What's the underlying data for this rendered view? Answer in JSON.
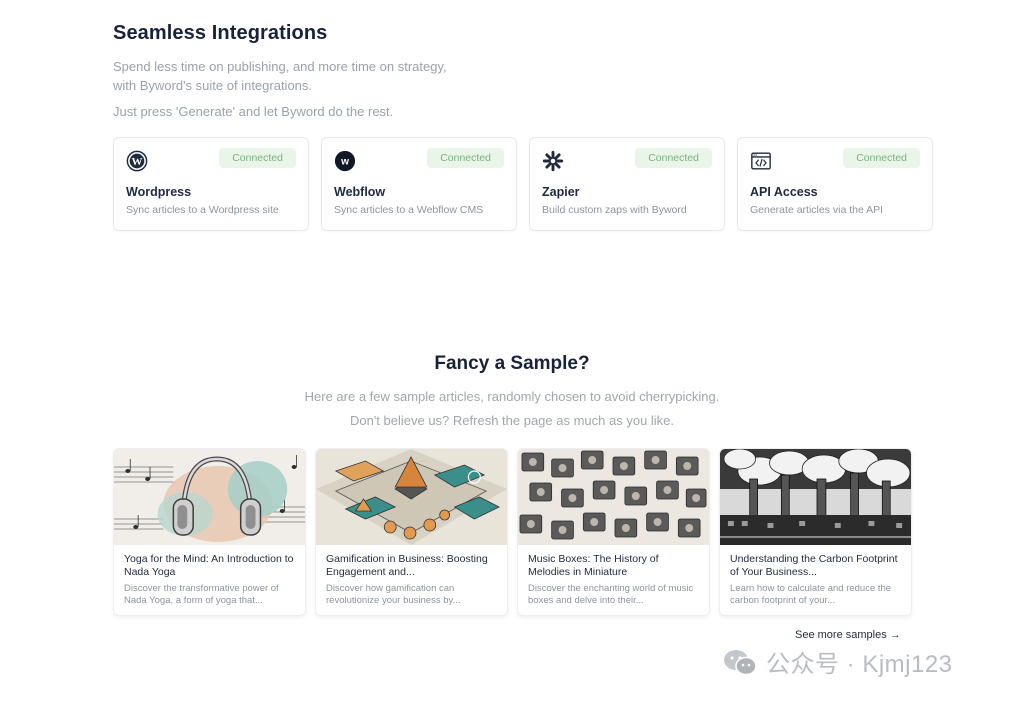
{
  "integrations": {
    "title": "Seamless Integrations",
    "intro": "Spend less time on publishing, and more time on strategy, with Byword's suite of integrations.",
    "intro2": "Just press 'Generate' and let Byword do the rest.",
    "cards": [
      {
        "name": "Wordpress",
        "desc": "Sync articles to a Wordpress site",
        "status": "Connected",
        "icon": "wordpress-icon"
      },
      {
        "name": "Webflow",
        "desc": "Sync articles to a Webflow CMS",
        "status": "Connected",
        "icon": "webflow-icon"
      },
      {
        "name": "Zapier",
        "desc": "Build custom zaps with Byword",
        "status": "Connected",
        "icon": "zapier-icon"
      },
      {
        "name": "API Access",
        "desc": "Generate articles via the API",
        "status": "Connected",
        "icon": "code-window-icon"
      }
    ]
  },
  "samples": {
    "title": "Fancy a Sample?",
    "subtitle1": "Here are a few sample articles, randomly chosen to avoid cherrypicking.",
    "subtitle2": "Don't believe us? Refresh the page as much as you like.",
    "articles": [
      {
        "title": "Yoga for the Mind: An Introduction to Nada Yoga",
        "desc": "Discover the transformative power of Nada Yoga, a form of yoga that..."
      },
      {
        "title": "Gamification in Business: Boosting Engagement and...",
        "desc": "Discover how gamification can revolutionize your business by..."
      },
      {
        "title": "Music Boxes: The History of Melodies in Miniature",
        "desc": "Discover the enchanting world of music boxes and delve into their..."
      },
      {
        "title": "Understanding the Carbon Footprint of Your Business...",
        "desc": "Learn how to calculate and reduce the carbon footprint of your..."
      }
    ],
    "see_more": "See more samples →"
  },
  "watermark": {
    "text": "公众号 · Kjmj123"
  },
  "colors": {
    "accent_green_bg": "#eaf5e9",
    "accent_green_text": "#7bb07e",
    "heading": "#182238"
  }
}
